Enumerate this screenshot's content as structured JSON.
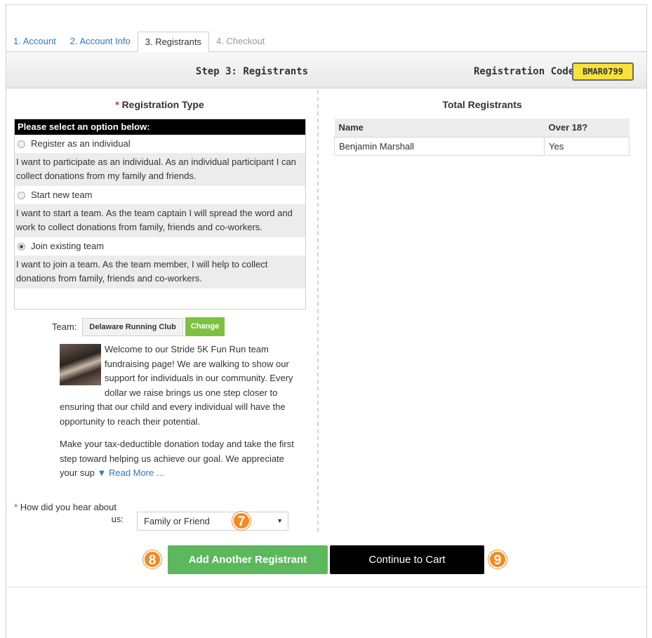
{
  "tabs": [
    {
      "label": "1. Account"
    },
    {
      "label": "2. Account Info"
    },
    {
      "label": "3. Registrants"
    },
    {
      "label": "4. Checkout"
    }
  ],
  "step": {
    "title": "Step 3: Registrants",
    "code_label": "Registration Code:",
    "code_value": "BMAR0799"
  },
  "registration_type": {
    "required_mark": "*",
    "title": "Registration Type",
    "header": "Please select an option below:",
    "options": [
      {
        "label": "Register as an individual",
        "selected": false,
        "description": "I want to participate as an individual.  As an individual participant I can collect donations from my family and friends."
      },
      {
        "label": "Start new team",
        "selected": false,
        "description": "I want to start a team.  As the team captain I will spread the word and work to collect donations from family, friends and co-workers."
      },
      {
        "label": "Join existing team",
        "selected": true,
        "description": "I want to join a team.  As the team member, I will help to collect donations from family, friends and co-workers."
      }
    ]
  },
  "team": {
    "label": "Team:",
    "name": "Delaware Running Club",
    "change_label": "Change",
    "desc_p1": "Welcome to our Stride 5K Fun Run team fundraising page!  We are walking to show our support for individuals in our community.  Every dollar we raise brings us one step closer to ensuring that our child and every individual will have the opportunity to reach their potential.",
    "desc_p2": "Make your tax-deductible donation today and take the first step toward helping us achieve our goal. We appreciate your sup",
    "read_more": "▼ Read More ..."
  },
  "hear": {
    "required_mark": "*",
    "label_line1": "How did you hear about",
    "label_line2": "us:",
    "selected": "Family or Friend",
    "arrow": "▼"
  },
  "registrants": {
    "title": "Total Registrants",
    "columns": [
      "Name",
      "Over 18?"
    ],
    "rows": [
      [
        "Benjamin Marshall",
        "Yes"
      ]
    ]
  },
  "buttons": {
    "add_label": "Add Another Registrant",
    "cart_label": "Continue to Cart"
  },
  "markers": [
    "7",
    "8",
    "9"
  ],
  "colors": {
    "accent_green": "#5cb85c",
    "change_green": "#7cc142",
    "marker_orange": "#f08a24",
    "code_yellow": "#f7e23a",
    "link_blue": "#2a7ac4"
  }
}
